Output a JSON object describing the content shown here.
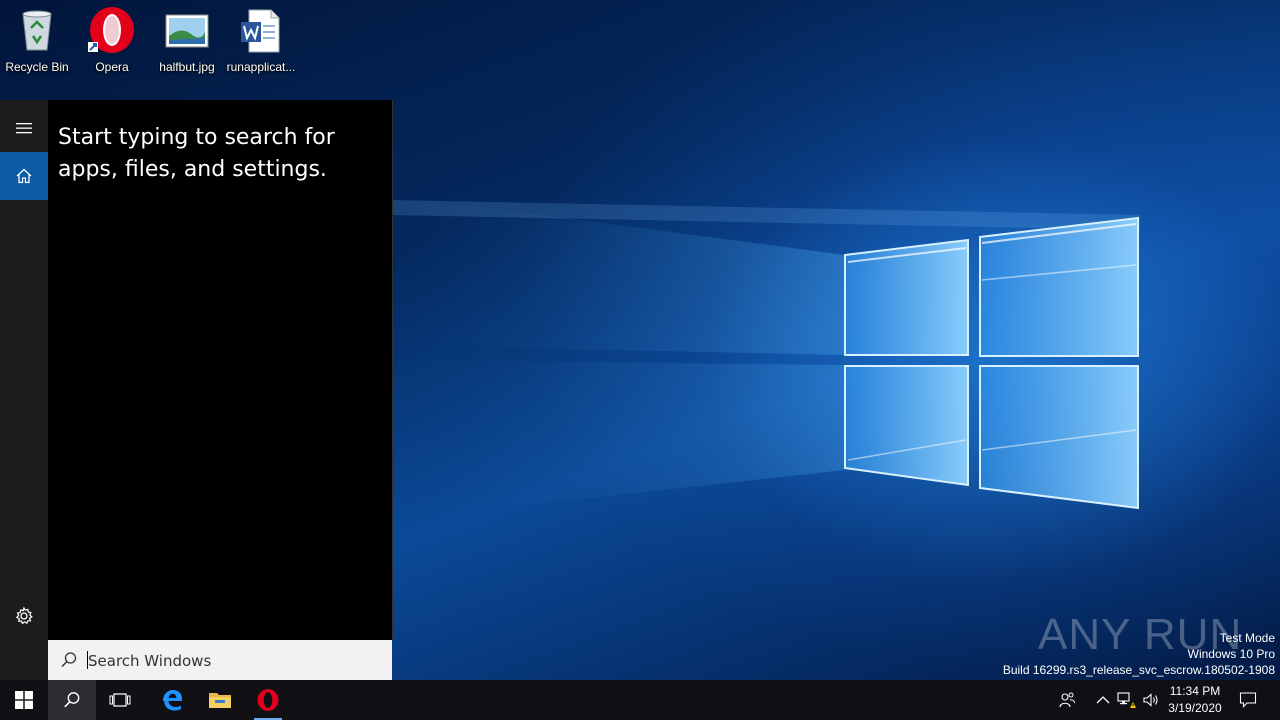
{
  "desktop": {
    "icons": [
      {
        "label": "Recycle Bin"
      },
      {
        "label": "Opera"
      },
      {
        "label": "halfbut.jpg"
      },
      {
        "label": "runapplicat..."
      }
    ]
  },
  "start": {
    "prompt": "Start typing to search for apps, files, and settings.",
    "search_placeholder": "Search Windows",
    "rail": [
      "menu-icon",
      "home-icon",
      "settings-icon"
    ],
    "accent": "#0a5aa4"
  },
  "watermark": {
    "brand": "ANY RUN",
    "lines": [
      "Test Mode",
      "Windows 10 Pro",
      "Build 16299.rs3_release_svc_escrow.180502-1908"
    ]
  },
  "taskbar": {
    "apps": [
      "start-icon",
      "search-icon",
      "task-view-icon",
      "edge-icon",
      "file-explorer-icon",
      "opera-icon"
    ],
    "time": "11:34 PM",
    "date": "3/19/2020"
  }
}
